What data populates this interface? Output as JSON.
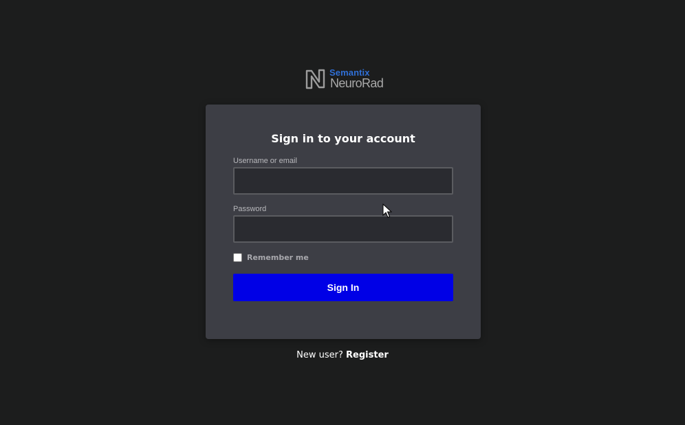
{
  "logo": {
    "brand": "Semantix",
    "product": "NeuroRad",
    "icon": "neurorad-logo-mark-icon"
  },
  "form": {
    "title": "Sign in to your account",
    "username": {
      "label": "Username or email",
      "value": "",
      "placeholder": ""
    },
    "password": {
      "label": "Password",
      "value": "",
      "placeholder": ""
    },
    "remember_me": {
      "label": "Remember me",
      "checked": false
    },
    "submit_label": "Sign In"
  },
  "footer": {
    "prompt": "New user?",
    "register_label": "Register"
  },
  "colors": {
    "background": "#1c1d1d",
    "card": "#3d3e45",
    "primary_button": "#0000e6",
    "brand_blue": "#2f6fd6",
    "logo_grey": "#a9a9a9"
  }
}
